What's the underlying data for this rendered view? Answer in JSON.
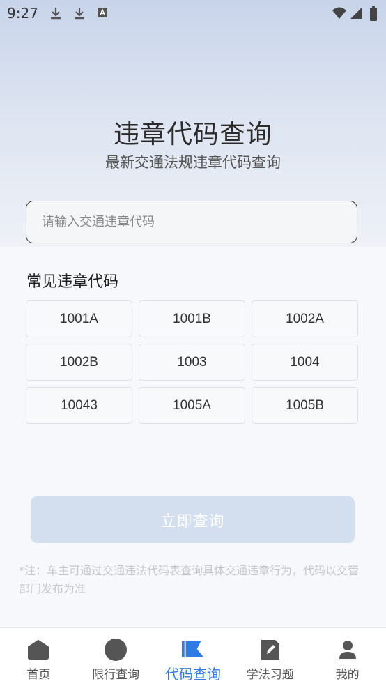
{
  "status_bar": {
    "time": "9:27",
    "icons": [
      "download-icon",
      "download-icon",
      "a-icon",
      "wifi-icon",
      "signal-icon",
      "battery-icon"
    ]
  },
  "header": {
    "title": "违章代码查询",
    "subtitle": "最新交通法规违章代码查询"
  },
  "search": {
    "placeholder": "请输入交通违章代码",
    "value": ""
  },
  "common_codes": {
    "title": "常见违章代码",
    "codes": [
      "1001A",
      "1001B",
      "1002A",
      "1002B",
      "1003",
      "1004",
      "10043",
      "1005A",
      "1005B"
    ]
  },
  "query_button": {
    "label": "立即查询"
  },
  "note": {
    "text": "*注：车主可通过交通违法代码表查询具体交通违章行为，代码以交管部门发布为准"
  },
  "bottom_nav": {
    "items": [
      {
        "label": "首页",
        "icon": "home-icon",
        "active": false
      },
      {
        "label": "限行查询",
        "icon": "circle-icon",
        "active": false
      },
      {
        "label": "代码查询",
        "icon": "flag-icon",
        "active": true
      },
      {
        "label": "学法习题",
        "icon": "edit-icon",
        "active": false
      },
      {
        "label": "我的",
        "icon": "user-icon",
        "active": false
      }
    ]
  },
  "colors": {
    "accent": "#2f7ae5",
    "button_disabled": "#d3deef",
    "icon_gray": "#555555"
  }
}
